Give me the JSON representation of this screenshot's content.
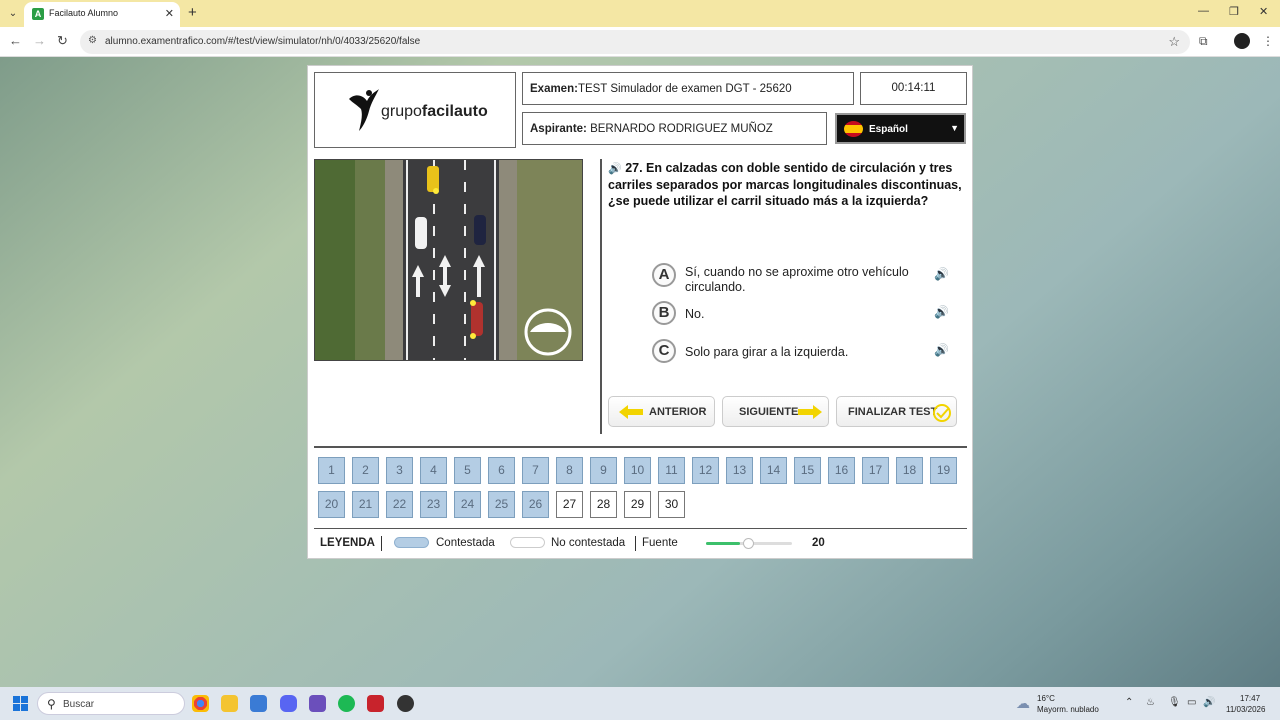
{
  "browser": {
    "tab_title": "Facilauto Alumno",
    "url": "alumno.examentrafico.com/#/test/view/simulator/nh/0/4033/25620/false"
  },
  "header": {
    "logo_text_prefix": "grupo",
    "logo_text_bold": "facilauto",
    "exam_label": "Examen:",
    "exam_value": "TEST Simulador de examen DGT - 25620",
    "timer": "00:14:11",
    "aspirante_label": "Aspirante:",
    "aspirante_value": "BERNARDO RODRIGUEZ MUÑOZ",
    "language": "Español"
  },
  "question": {
    "number_text": "27. En calzadas con doble sentido de circulación y tres carriles separados por marcas longitudinales discontinuas, ¿se puede utilizar el carril situado más a la izquierda?"
  },
  "answers": [
    {
      "letter": "A",
      "text": "Sí, cuando no se aproxime otro vehículo circulando."
    },
    {
      "letter": "B",
      "text": "No."
    },
    {
      "letter": "C",
      "text": "Solo para girar a la izquierda."
    }
  ],
  "buttons": {
    "prev": "ANTERIOR",
    "next": "SIGUIENTE",
    "finish": "FINALIZAR TEST"
  },
  "question_nav": {
    "answered": [
      "1",
      "2",
      "3",
      "4",
      "5",
      "6",
      "7",
      "8",
      "9",
      "10",
      "11",
      "12",
      "13",
      "14",
      "15",
      "16",
      "17",
      "18",
      "19",
      "20",
      "21",
      "22",
      "23",
      "24",
      "25",
      "26"
    ],
    "unanswered": [
      "27",
      "28",
      "29",
      "30"
    ]
  },
  "legend": {
    "title": "LEYENDA",
    "answered_label": "Contestada",
    "unanswered_label": "No contestada",
    "font_label": "Fuente",
    "font_value": "20",
    "font_slider_fraction": 0.5,
    "answered_color": "#b4cde4"
  },
  "taskbar": {
    "search_placeholder": "Buscar",
    "weather_temp": "16°C",
    "weather_desc": "Mayorm. nublado",
    "time": "17:47",
    "date": "11/03/2026"
  }
}
